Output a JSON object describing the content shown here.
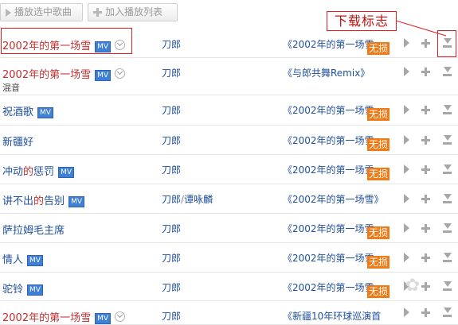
{
  "toolbar": {
    "play_selected": "播放选中歌曲",
    "add_to_playlist": "加入播放列表"
  },
  "callout": {
    "text": "下载标志"
  },
  "badges": {
    "mv": "MV",
    "lossless": "无损"
  },
  "colors": {
    "link": "#20509e",
    "lossless": "#f07a16",
    "annotation": "#e02020"
  },
  "songs": [
    {
      "title": "2002年的第一场雪",
      "artist": "刀郎",
      "album": "《2002年的第一场雪",
      "mv": true,
      "more": true,
      "lossless": true,
      "title_red": true
    },
    {
      "title": "2002年的第一场雪",
      "artist": "刀郎",
      "album": "《与郎共舞Remix》",
      "mv": true,
      "more": true,
      "lossless": false,
      "title_red": true,
      "note": "混音"
    },
    {
      "title": "祝酒歌",
      "artist": "刀郎",
      "album": "《2002年的第一场雪",
      "mv": true,
      "lossless": true
    },
    {
      "title": "新疆好",
      "artist": "刀郎",
      "album": "《2002年的第一场雪",
      "mv": false,
      "lossless": true
    },
    {
      "title_pre": "冲动",
      "title_kw": "的",
      "title_post": "惩罚",
      "artist": "刀郎",
      "album": "《2002年的第一场雪",
      "mv": true,
      "lossless": true
    },
    {
      "title_pre": "讲不出",
      "title_kw": "的",
      "title_post": "告别",
      "artist": "刀郎",
      "artist2": "谭咏麟",
      "album": "《2002年的第一场雪》",
      "mv": true,
      "lossless": false
    },
    {
      "title": "萨拉姆毛主席",
      "artist": "刀郎",
      "album": "《2002年的第一场雪",
      "mv": false,
      "lossless": true
    },
    {
      "title": "情人",
      "artist": "刀郎",
      "album": "《2002年的第一场雪",
      "mv": true,
      "lossless": true
    },
    {
      "title": "驼铃",
      "artist": "刀郎",
      "album": "《2002年的第一场雪",
      "mv": true,
      "lossless": true
    },
    {
      "title": "2002年的第一场雪",
      "artist": "刀郎",
      "album": "《新疆10年环球巡演首",
      "mv": true,
      "more": true,
      "lossless": false,
      "title_red": true
    }
  ]
}
